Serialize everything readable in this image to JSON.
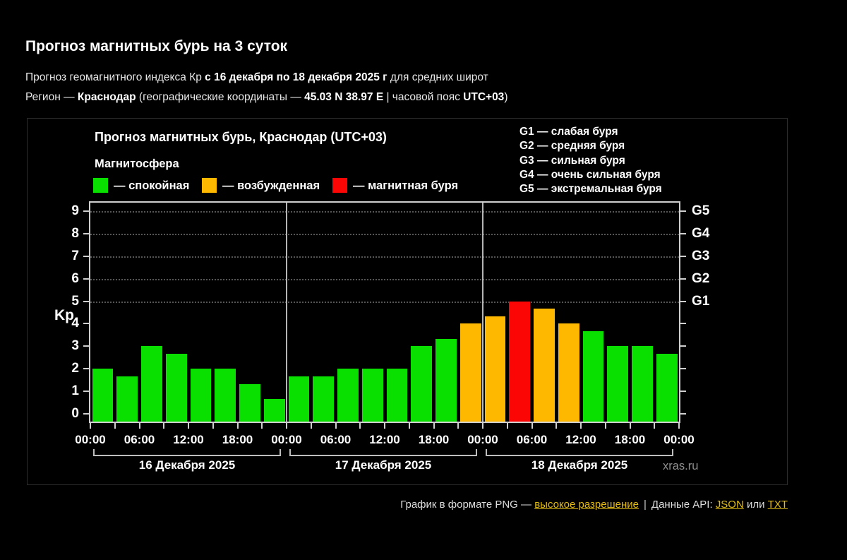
{
  "page": {
    "title": "Прогноз магнитных бурь на 3 суток",
    "subtitle1": {
      "pre": "Прогноз геомагнитного индекса Кр ",
      "bold": "с 16 декабря по 18 декабря 2025 г",
      "post": " для средних широт"
    },
    "subtitle2": {
      "pre": "Регион — ",
      "region": "Краснодар",
      "mid": " (географические координаты — ",
      "coords": "45.03 N 38.97 E",
      "mid2": " | часовой пояс ",
      "tz": "UTC+03",
      "post": ")"
    }
  },
  "chart": {
    "title": "Прогноз магнитных бурь, Краснодар (UTC+03)",
    "legend_title": "Магнитосфера",
    "legend": [
      {
        "key": "green",
        "label": "— спокойная"
      },
      {
        "key": "orange",
        "label": "— возбужденная"
      },
      {
        "key": "red",
        "label": "— магнитная буря"
      }
    ],
    "g_scale": [
      "G1 — слабая буря",
      "G2 — средняя буря",
      "G3 — сильная буря",
      "G4 — очень сильная буря",
      "G5 — экстремальная буря"
    ],
    "ylabel": "Kp",
    "watermark": "xras.ru"
  },
  "chart_data": {
    "type": "bar",
    "title": "Прогноз магнитных бурь, Краснодар (UTC+03)",
    "ylabel": "Kp",
    "ylim": [
      0,
      9
    ],
    "y_ticks": [
      0,
      1,
      2,
      3,
      4,
      5,
      6,
      7,
      8,
      9
    ],
    "gridlines_at": [
      5,
      6,
      7,
      8,
      9
    ],
    "grid": "dotted, storm levels only",
    "legend_position": "top",
    "x_tick_labels": [
      "00:00",
      "06:00",
      "12:00",
      "18:00",
      "00:00",
      "06:00",
      "12:00",
      "18:00",
      "00:00",
      "06:00",
      "12:00",
      "18:00",
      "00:00"
    ],
    "right_axis_labels": [
      {
        "kp": 5,
        "label": "G1"
      },
      {
        "kp": 6,
        "label": "G2"
      },
      {
        "kp": 7,
        "label": "G3"
      },
      {
        "kp": 8,
        "label": "G4"
      },
      {
        "kp": 9,
        "label": "G5"
      }
    ],
    "palette": {
      "green": "#0ae000",
      "orange": "#ffb800",
      "red": "#fb0505"
    },
    "days": [
      {
        "label": "16 Декабря 2025",
        "values": [
          2.0,
          1.67,
          3.0,
          2.67,
          2.0,
          2.0,
          1.33,
          0.67
        ],
        "colors": [
          "green",
          "green",
          "green",
          "green",
          "green",
          "green",
          "green",
          "green"
        ]
      },
      {
        "label": "17 Декабря 2025",
        "values": [
          1.67,
          1.67,
          2.0,
          2.0,
          2.0,
          3.0,
          3.33,
          4.0
        ],
        "colors": [
          "green",
          "green",
          "green",
          "green",
          "green",
          "green",
          "green",
          "orange"
        ]
      },
      {
        "label": "18 Декабря 2025",
        "values": [
          4.33,
          5.0,
          4.67,
          4.0,
          3.67,
          3.0,
          3.0,
          2.67
        ],
        "colors": [
          "orange",
          "red",
          "orange",
          "orange",
          "green",
          "green",
          "green",
          "green"
        ]
      }
    ]
  },
  "footer": {
    "text1": "График в формате PNG — ",
    "link_highres": "высокое разрешение",
    "pipe": "|",
    "text2": "Данные API: ",
    "link_json": "JSON",
    "text3": " или ",
    "link_txt": "TXT"
  }
}
